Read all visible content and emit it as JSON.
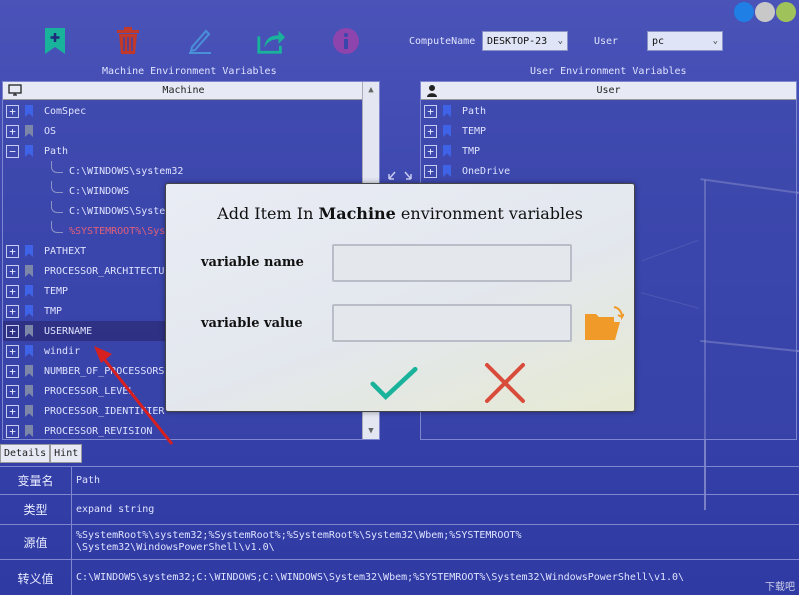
{
  "colors": {
    "accent_green": "#18b39a",
    "accent_red": "#c0392b",
    "bookmark_blue": "#3f63e6",
    "bookmark_gray": "#7b86a8",
    "folder_orange": "#f09a2a",
    "win_blue": "#1f7fe5",
    "win_gray": "#c8c8c8",
    "win_green": "#9fc35a"
  },
  "window_controls": [
    "minimize-button",
    "maximize-button",
    "close-button"
  ],
  "toolbar": {
    "icons": [
      {
        "name": "add-bookmark-icon",
        "color": "#18b39a"
      },
      {
        "name": "delete-icon",
        "color": "#c0392b"
      },
      {
        "name": "edit-icon",
        "color": "#4a90d9"
      },
      {
        "name": "export-icon",
        "color": "#18b39a"
      },
      {
        "name": "info-icon",
        "color": "#8e44ad"
      }
    ],
    "compute_name_label": "ComputeName",
    "compute_name_value": "DESKTOP-23",
    "user_label": "User",
    "user_value": "pc"
  },
  "machine_section": {
    "title": "Machine Environment Variables",
    "header": "Machine",
    "rows": [
      {
        "label": "ComSpec",
        "expander": "+",
        "marker": "blue"
      },
      {
        "label": "OS",
        "expander": "+",
        "marker": "gray"
      },
      {
        "label": "Path",
        "expander": "−",
        "marker": "blue"
      },
      {
        "label": "PATHEXT",
        "expander": "+",
        "marker": "blue"
      },
      {
        "label": "PROCESSOR_ARCHITECTU",
        "expander": "+",
        "marker": "gray"
      },
      {
        "label": "TEMP",
        "expander": "+",
        "marker": "blue"
      },
      {
        "label": "TMP",
        "expander": "+",
        "marker": "blue"
      },
      {
        "label": "USERNAME",
        "expander": "+",
        "marker": "gray"
      },
      {
        "label": "windir",
        "expander": "+",
        "marker": "blue"
      },
      {
        "label": "NUMBER_OF_PROCESSORS",
        "expander": "+",
        "marker": "gray"
      },
      {
        "label": "PROCESSOR_LEVEL",
        "expander": "+",
        "marker": "gray"
      },
      {
        "label": "PROCESSOR_IDENTIFIER",
        "expander": "+",
        "marker": "gray"
      },
      {
        "label": "PROCESSOR_REVISION",
        "expander": "+",
        "marker": "gray"
      }
    ],
    "path_children": [
      "C:\\WINDOWS\\system32",
      "C:\\WINDOWS",
      "C:\\WINDOWS\\Syste",
      "%SYSTEMROOT%\\Sys"
    ]
  },
  "user_section": {
    "title": "User Environment Variables",
    "header": "User",
    "rows": [
      {
        "label": "Path",
        "expander": "+",
        "marker": "blue"
      },
      {
        "label": "TEMP",
        "expander": "+",
        "marker": "blue"
      },
      {
        "label": "TMP",
        "expander": "+",
        "marker": "blue"
      },
      {
        "label": "OneDrive",
        "expander": "+",
        "marker": "blue"
      }
    ]
  },
  "tabs": [
    "Details",
    "Hint"
  ],
  "details": [
    {
      "key": "变量名",
      "value": "Path"
    },
    {
      "key": "类型",
      "value": "expand string"
    },
    {
      "key": "源值",
      "value": "%SystemRoot%\\system32;%SystemRoot%;%SystemRoot%\\System32\\Wbem;%SYSTEMROOT%\n\\System32\\WindowsPowerShell\\v1.0\\"
    },
    {
      "key": "转义值",
      "value": "C:\\WINDOWS\\system32;C:\\WINDOWS;C:\\WINDOWS\\System32\\Wbem;%SYSTEMROOT%\\System32\\WindowsPowerShell\\v1.0\\"
    }
  ],
  "dialog": {
    "title_prefix": "Add Item In ",
    "title_bold": "Machine",
    "title_suffix": " environment variables",
    "name_label": "variable name",
    "name_value": "",
    "value_label": "variable value",
    "value_value": "",
    "confirm_icon": "checkmark-icon",
    "cancel_icon": "close-x-icon",
    "browse_icon": "folder-open-icon"
  },
  "watermark": "下载吧"
}
